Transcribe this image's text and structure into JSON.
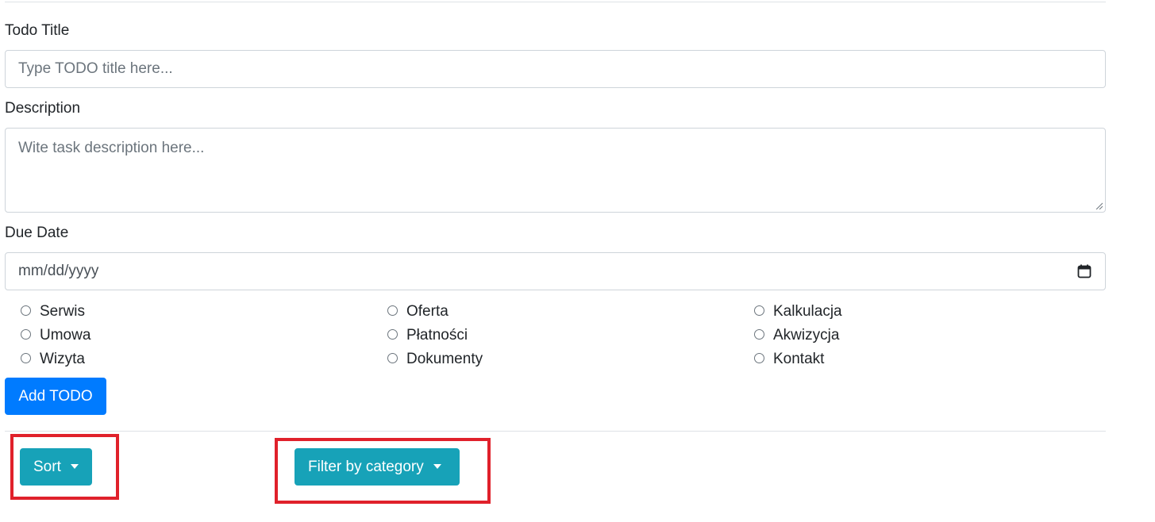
{
  "form": {
    "title_label": "Todo Title",
    "title_placeholder": "Type TODO title here...",
    "description_label": "Description",
    "description_placeholder": "Wite task description here...",
    "due_date_label": "Due Date",
    "due_date_placeholder": "mm/dd/yyyy",
    "categories": [
      "Serwis",
      "Oferta",
      "Kalkulacja",
      "Umowa",
      "Płatności",
      "Akwizycja",
      "Wizyta",
      "Dokumenty",
      "Kontakt"
    ],
    "add_button": "Add TODO"
  },
  "toolbar": {
    "sort_label": "Sort",
    "filter_label": "Filter by category"
  },
  "colors": {
    "primary": "#007bff",
    "info": "#17a2b8",
    "highlight": "#e0212b"
  }
}
